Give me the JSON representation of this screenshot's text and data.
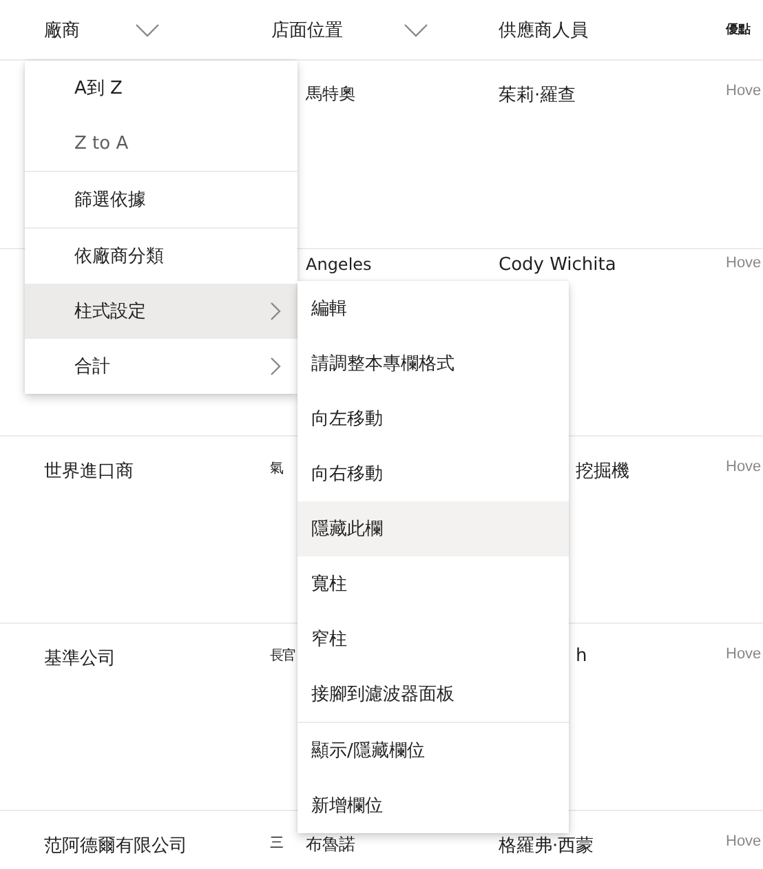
{
  "columns": [
    {
      "label": "廠商",
      "dropdown": true
    },
    {
      "label": "店面位置",
      "dropdown": true
    },
    {
      "label": "供應商人員",
      "dropdown": false
    },
    {
      "label": "優點",
      "dropdown": false,
      "small": true
    }
  ],
  "rows": [
    {
      "vendor": "",
      "location": {
        "text": "馬特奧"
      },
      "staff": {
        "text": "茱莉·羅查"
      },
      "column_4": "Hove"
    },
    {
      "vendor": "",
      "location": {
        "text": "Angeles"
      },
      "staff": {
        "text": "Cody Wichita"
      },
      "column_4": "Hove"
    },
    {
      "vendor": "世界進口商",
      "location": {
        "prefix": "氣"
      },
      "staff": {
        "tail": "挖掘機"
      },
      "column_4": "Hove"
    },
    {
      "vendor": "基準公司",
      "location": {
        "prefix": "長官"
      },
      "staff": {
        "tail": "h"
      },
      "column_4": "Hove"
    },
    {
      "vendor": "范阿德爾有限公司",
      "location": {
        "prefix": "三",
        "text": "布魯諾"
      },
      "staff": {
        "text": "格羅弗·西蒙"
      },
      "column_4": "Hove"
    }
  ],
  "column_menu": {
    "items": [
      {
        "label": "A到 Z",
        "disabled": false,
        "selected": false,
        "submenu": false
      },
      {
        "label": "Z to A",
        "disabled": true,
        "selected": false,
        "submenu": false,
        "divider_after": true
      },
      {
        "label": "篩選依據",
        "disabled": false,
        "selected": false,
        "submenu": false,
        "divider_after": true
      },
      {
        "label": "依廠商分類",
        "disabled": false,
        "selected": false,
        "submenu": false
      },
      {
        "label": "柱式設定",
        "disabled": false,
        "selected": true,
        "submenu": true
      },
      {
        "label": "合計",
        "disabled": false,
        "selected": false,
        "submenu": true
      }
    ]
  },
  "column_settings_submenu": {
    "items": [
      {
        "label": "編輯",
        "selected": false
      },
      {
        "label": "請調整本專欄格式",
        "selected": false
      },
      {
        "label": "向左移動",
        "selected": false
      },
      {
        "label": "向右移動",
        "selected": false
      },
      {
        "label": "隱藏此欄",
        "selected": true
      },
      {
        "label": "寬柱",
        "selected": false
      },
      {
        "label": "窄柱",
        "selected": false
      },
      {
        "label": "接腳到濾波器面板",
        "selected": false,
        "divider_after": true
      },
      {
        "label": "顯示/隱藏欄位",
        "selected": false
      },
      {
        "label": "新增欄位",
        "selected": false
      }
    ]
  }
}
